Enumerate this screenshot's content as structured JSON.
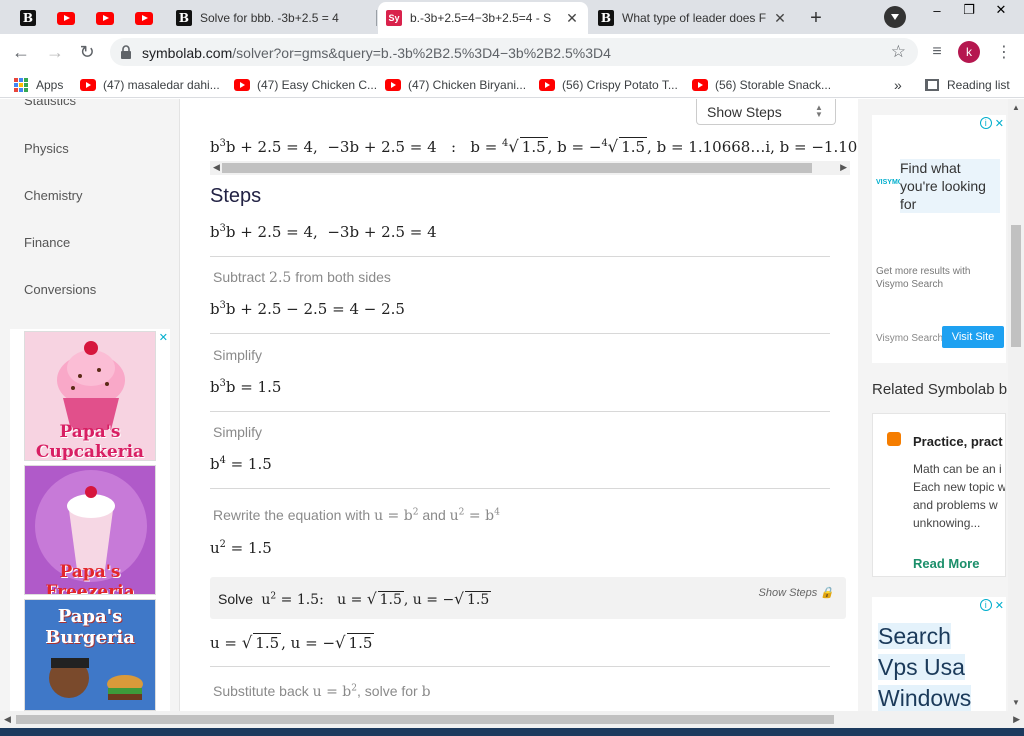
{
  "browser": {
    "tabs": [
      {
        "title": "Solve for bbb. -3b+2.5 = 4",
        "favicon": "b-icon"
      },
      {
        "title": "b.-3b+2.5=4−3b+2.5=4 - S",
        "favicon": "symbolab-icon"
      },
      {
        "title": "What type of leader does F",
        "favicon": "b-icon"
      }
    ],
    "url_host": "symbolab.com",
    "url_path": "/solver?or=gms&query=b.-3b%2B2.5%3D4−3b%2B2.5%3D4",
    "avatar_letter": "k",
    "window_controls": [
      "–",
      "❐",
      "✕"
    ],
    "bookmarks": [
      {
        "label": "Apps"
      },
      {
        "label": "(47) masaledar dahi..."
      },
      {
        "label": "(47) Easy Chicken C..."
      },
      {
        "label": "(47) Chicken Biryani..."
      },
      {
        "label": "(56) Crispy Potato T..."
      },
      {
        "label": "(56) Storable Snack..."
      }
    ],
    "overflow": "»",
    "reading_list": "Reading list"
  },
  "leftnav": {
    "items": [
      "Statistics",
      "Physics",
      "Chemistry",
      "Finance",
      "Conversions"
    ]
  },
  "left_ad": {
    "games": [
      "Papa's Cupcakeria",
      "Papa's Freezeria",
      "Papa's Burgeria"
    ]
  },
  "main": {
    "show_steps_top": "Show Steps",
    "steps_title": "Steps",
    "show_steps_inline": "Show Steps",
    "step_labels": {
      "subtract": "Subtract",
      "subtract_tail": "from both sides",
      "simplify": "Simplify",
      "rewrite": "Rewrite the equation with",
      "rewrite_and": "and",
      "solve": "Solve",
      "substitute": "Substitute back",
      "substitute_tail": ", solve for"
    }
  },
  "rightbar": {
    "ad_top": {
      "headline": "Find what you're looking for",
      "brand_mark": "VISYMO SEARCH",
      "more": "Get more results with Visymo Search",
      "brand": "Visymo Search",
      "button": "Visit Site"
    },
    "related_title": "Related Symbolab b",
    "related_card": {
      "title": "Practice, pract",
      "body": "Math can be an i Each new topic w and problems w unknowing...",
      "read_more": "Read More"
    },
    "ad_bottom": {
      "line1": "Search",
      "line2": "Vps Usa",
      "line3": "Windows"
    }
  }
}
